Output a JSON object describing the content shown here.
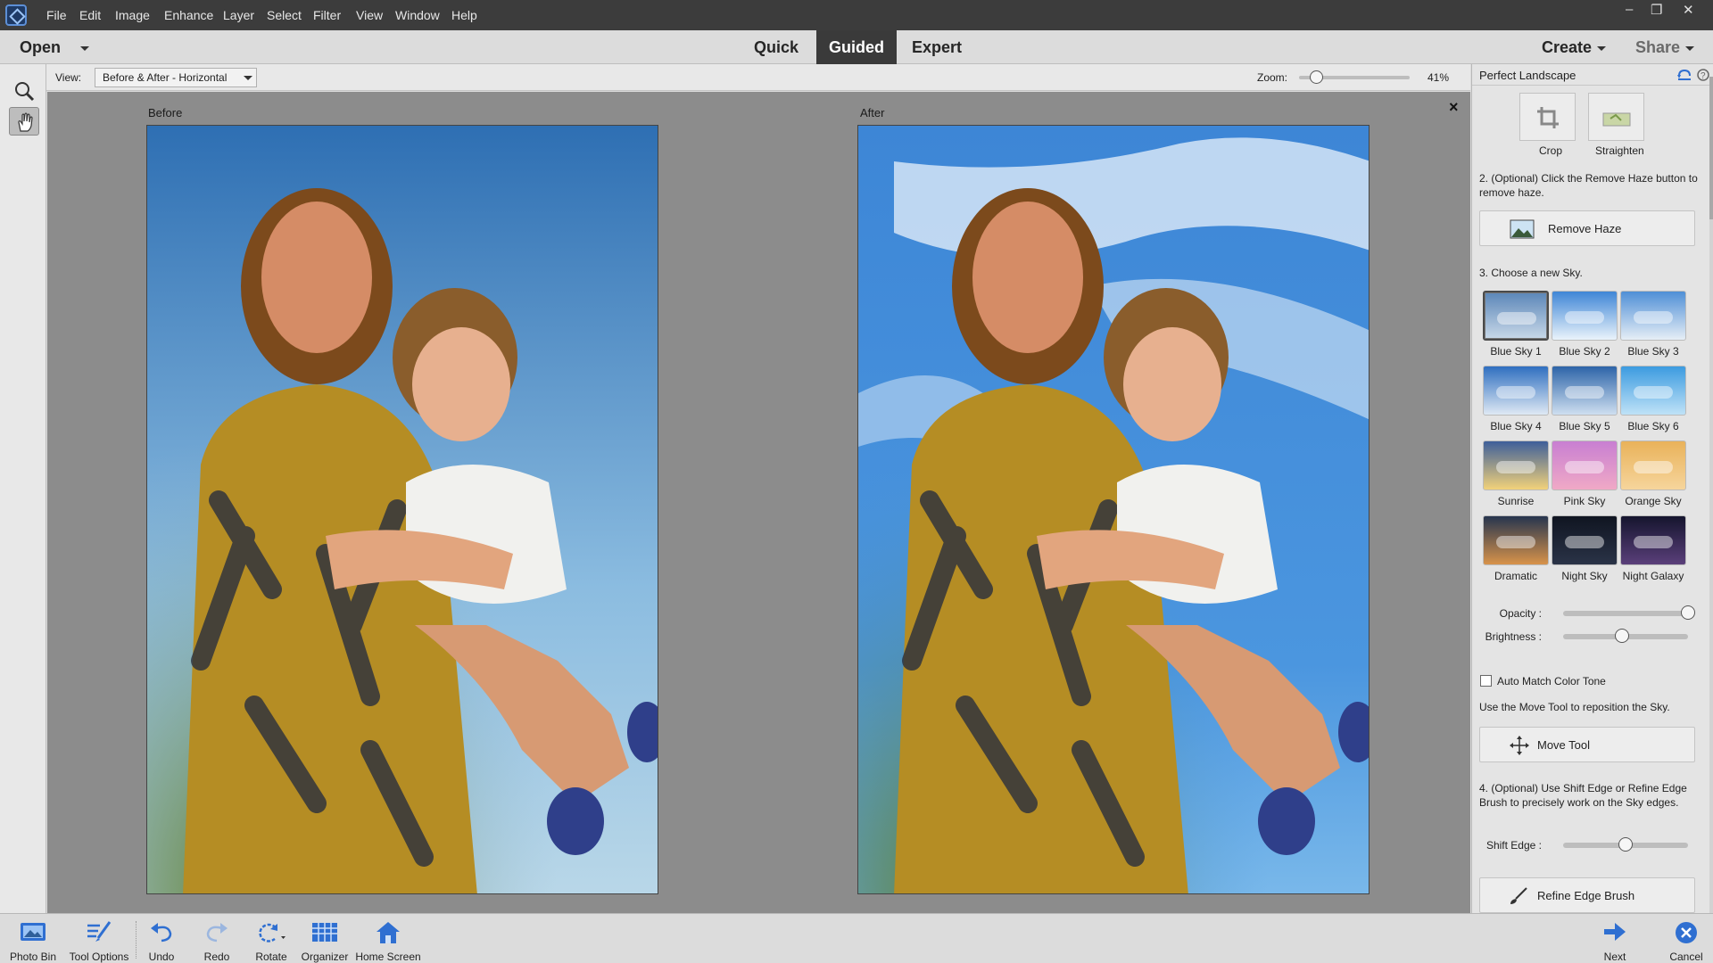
{
  "menubar": {
    "items": [
      "File",
      "Edit",
      "Image",
      "Enhance",
      "Layer",
      "Select",
      "Filter",
      "View",
      "Window",
      "Help"
    ],
    "window_controls": [
      "–",
      "❐",
      "✕"
    ]
  },
  "modebar": {
    "open_label": "Open",
    "tabs": [
      {
        "label": "Quick"
      },
      {
        "label": "Guided"
      },
      {
        "label": "Expert"
      }
    ],
    "active_tab": "Guided",
    "create_label": "Create",
    "share_label": "Share"
  },
  "toolbar": {
    "view_label": "View:",
    "view_value": "Before & After - Horizontal",
    "zoom_label": "Zoom:",
    "zoom_value": "41%",
    "zoom_level": 0.16
  },
  "canvas": {
    "before_label": "Before",
    "after_label": "After",
    "close_glyph": "×"
  },
  "panel": {
    "title": "Perfect Landscape",
    "crop_label": "Crop",
    "straighten_label": "Straighten",
    "step2_text": "2. (Optional) Click the Remove Haze button to remove haze.",
    "remove_haze_label": "Remove Haze",
    "step3_text": "3. Choose a new Sky.",
    "skies": [
      {
        "label": "Blue Sky 1",
        "c1": "#5b86b8",
        "c2": "#c8d8e8"
      },
      {
        "label": "Blue Sky 2",
        "c1": "#3f86d6",
        "c2": "#eaf3fb"
      },
      {
        "label": "Blue Sky 3",
        "c1": "#4f8fd6",
        "c2": "#e6eef6"
      },
      {
        "label": "Blue Sky 4",
        "c1": "#2f6fc0",
        "c2": "#dfe9f4"
      },
      {
        "label": "Blue Sky 5",
        "c1": "#2d64a8",
        "c2": "#cfdff0"
      },
      {
        "label": "Blue Sky 6",
        "c1": "#3c9be0",
        "c2": "#bfe2f7"
      },
      {
        "label": "Sunrise",
        "c1": "#3e5f9a",
        "c2": "#f2d27a"
      },
      {
        "label": "Pink Sky",
        "c1": "#c87fd2",
        "c2": "#f0a9c6"
      },
      {
        "label": "Orange Sky",
        "c1": "#e9b25a",
        "c2": "#f6d59c"
      },
      {
        "label": "Dramatic",
        "c1": "#26354f",
        "c2": "#d8934a"
      },
      {
        "label": "Night Sky",
        "c1": "#101521",
        "c2": "#2a3347"
      },
      {
        "label": "Night Galaxy",
        "c1": "#15152e",
        "c2": "#5a3f7a"
      }
    ],
    "selected_sky": "Blue Sky 1",
    "opacity_label": "Opacity :",
    "opacity_value": 1.0,
    "brightness_label": "Brightness :",
    "brightness_value": 0.47,
    "auto_match_label": "Auto Match Color Tone",
    "auto_match_checked": false,
    "move_tool_text": "Use the Move Tool to reposition the Sky.",
    "move_tool_label": "Move Tool",
    "step4_text": "4. (Optional) Use Shift Edge or Refine Edge Brush to precisely work on the Sky edges.",
    "shift_edge_label": "Shift Edge :",
    "shift_edge_value": 0.5,
    "refine_edge_label": "Refine Edge Brush"
  },
  "bottombar": {
    "items": [
      {
        "label": "Photo Bin",
        "icon": "photo-bin-icon"
      },
      {
        "label": "Tool Options",
        "icon": "tool-options-icon"
      },
      {
        "label": "Undo",
        "icon": "undo-icon"
      },
      {
        "label": "Redo",
        "icon": "redo-icon"
      },
      {
        "label": "Rotate",
        "icon": "rotate-icon"
      },
      {
        "label": "Organizer",
        "icon": "organizer-icon"
      },
      {
        "label": "Home Screen",
        "icon": "home-icon"
      }
    ],
    "next_label": "Next",
    "cancel_label": "Cancel"
  },
  "colors": {
    "accent": "#2f6fd1",
    "menubar_bg": "#3c3c3c",
    "active_tab_bg": "#3a3a3a"
  }
}
